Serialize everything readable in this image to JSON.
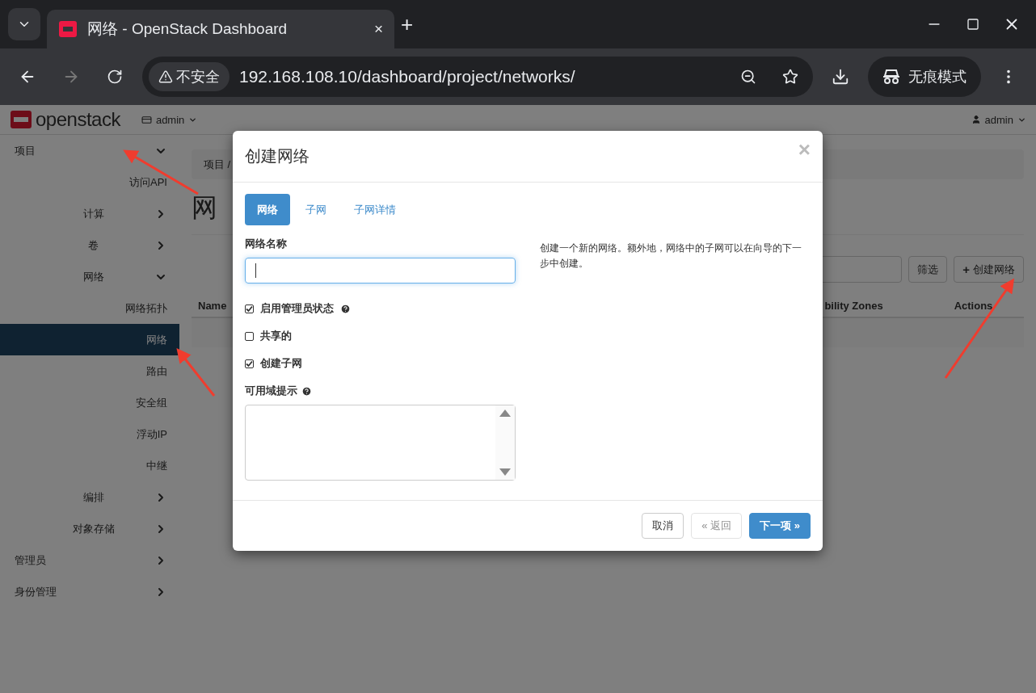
{
  "browser": {
    "tab": {
      "title": "网络 - OpenStack Dashboard",
      "close": "×"
    },
    "new_tab": "+",
    "address": {
      "security": "不安全",
      "url": "192.168.108.10/dashboard/project/networks/"
    },
    "incognito": "无痕模式"
  },
  "header": {
    "logo": "openstack",
    "project_menu": "admin",
    "user_menu": "admin"
  },
  "sidebar": {
    "items": [
      {
        "label": "项目",
        "expanded": true,
        "selected": false,
        "children": [
          {
            "label": "访问API",
            "selected": false
          },
          {
            "label": "计算",
            "expanded": false,
            "selected": false
          },
          {
            "label": "卷",
            "expanded": false,
            "selected": false
          },
          {
            "label": "网络",
            "expanded": true,
            "selected": false,
            "children": [
              {
                "label": "网络拓扑",
                "selected": false
              },
              {
                "label": "网络",
                "selected": true
              },
              {
                "label": "路由",
                "selected": false
              },
              {
                "label": "安全组",
                "selected": false
              },
              {
                "label": "浮动IP",
                "selected": false
              },
              {
                "label": "中继",
                "selected": false
              }
            ]
          },
          {
            "label": "编排",
            "expanded": false,
            "selected": false
          },
          {
            "label": "对象存储",
            "expanded": false,
            "selected": false
          }
        ]
      },
      {
        "label": "管理员",
        "expanded": false,
        "selected": false
      },
      {
        "label": "身份管理",
        "expanded": false,
        "selected": false
      }
    ]
  },
  "content": {
    "breadcrumb": "项目 /",
    "heading": "网",
    "filter_button": "筛选",
    "create_icon": "+",
    "create_button": "创建网络",
    "table": {
      "columns": [
        "Name",
        "bility Zones",
        "Actions"
      ]
    }
  },
  "dialog": {
    "title": "创建网络",
    "close": "×",
    "tabs": [
      {
        "label": "网络",
        "selected": true
      },
      {
        "label": "子网",
        "selected": false
      },
      {
        "label": "子网详情",
        "selected": false
      }
    ],
    "name_label": "网络名称",
    "options": [
      {
        "label": "启用管理员状态",
        "checked": true,
        "help": true
      },
      {
        "label": "共享的",
        "checked": false,
        "help": false
      },
      {
        "label": "创建子网",
        "checked": true,
        "help": false
      }
    ],
    "az_label": "可用域提示",
    "description": "创建一个新的网络。额外地，网络中的子网可以在向导的下一步中创建。",
    "buttons": [
      {
        "label": "取消",
        "kind": "default",
        "disabled": false
      },
      {
        "label": "« 返回",
        "kind": "default",
        "disabled": true
      },
      {
        "label": "下一项 »",
        "kind": "primary",
        "disabled": false
      }
    ]
  }
}
